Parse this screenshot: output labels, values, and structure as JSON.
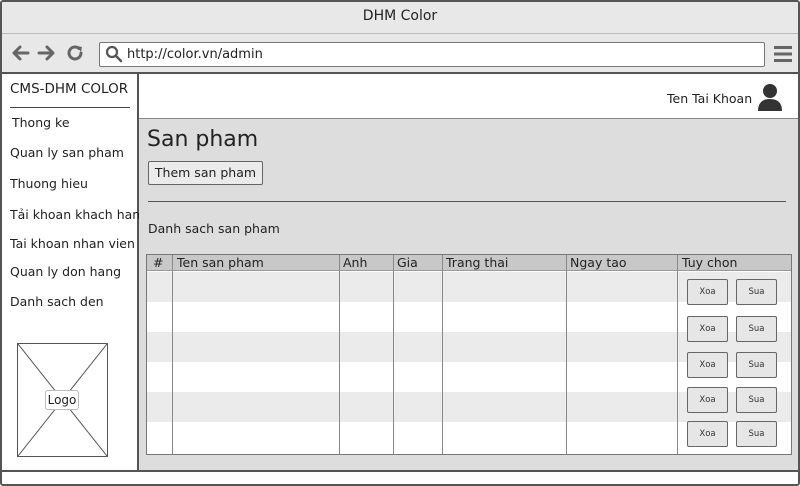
{
  "window": {
    "title": "DHM Color"
  },
  "browser": {
    "url": "http://color.vn/admin"
  },
  "sidebar": {
    "brand": "CMS-DHM COLOR",
    "items": [
      {
        "label": "Thong ke"
      },
      {
        "label": "Quan ly san pham"
      },
      {
        "label": "Thuong hieu"
      },
      {
        "label": "Tải khoan khach hang"
      },
      {
        "label": "Tai khoan nhan vien"
      },
      {
        "label": "Quan ly don hang"
      },
      {
        "label": "Danh sach den"
      }
    ],
    "logo_label": "Logo"
  },
  "header": {
    "account_name": "Ten Tai Khoan"
  },
  "main": {
    "title": "San pham",
    "add_button": "Them san pham",
    "list_title": "Danh sach san pham"
  },
  "table": {
    "columns": [
      "#",
      "Ten san pham",
      "Anh",
      "Gia",
      "Trang thai",
      "Ngay tao",
      "Tuy chon"
    ],
    "rows": [
      {
        "delete": "Xoa",
        "edit": "Sua"
      },
      {
        "delete": "Xoa",
        "edit": "Sua"
      },
      {
        "delete": "Xoa",
        "edit": "Sua"
      },
      {
        "delete": "Xoa",
        "edit": "Sua"
      },
      {
        "delete": "Xoa",
        "edit": "Sua"
      }
    ]
  },
  "colors": {
    "window_border": "#555555",
    "content_bg": "#dddddd",
    "table_header_bg": "#c8c8c8",
    "row_stripe": "#ebebeb"
  }
}
